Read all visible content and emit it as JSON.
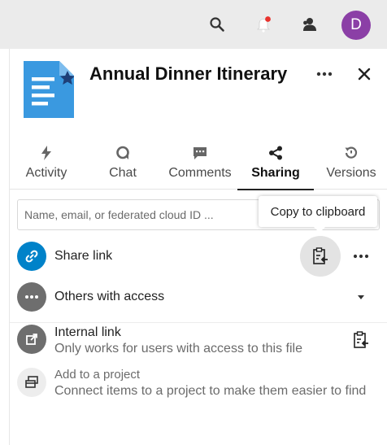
{
  "header": {
    "avatar_initial": "D",
    "notification_dot_color": "#e9322d",
    "icons": [
      "search-icon",
      "notifications-icon",
      "contacts-icon"
    ]
  },
  "file": {
    "title": "Annual Dinner Itinerary",
    "icon": "document-starred-icon",
    "icon_color": "#3a99e0"
  },
  "tabs": [
    {
      "label": "Activity",
      "icon": "lightning-icon"
    },
    {
      "label": "Chat",
      "icon": "chat-icon"
    },
    {
      "label": "Comments",
      "icon": "comment-icon"
    },
    {
      "label": "Sharing",
      "icon": "share-icon",
      "active": true
    },
    {
      "label": "Versions",
      "icon": "history-icon"
    }
  ],
  "sharing": {
    "search_placeholder": "Name, email, or federated cloud ID ...",
    "tooltip": "Copy to clipboard",
    "share_link_label": "Share link",
    "others_label": "Others with access",
    "internal_link_label": "Internal link",
    "internal_link_sub": "Only works for users with access to this file",
    "project_label": "Add to a project",
    "project_sub": "Connect items to a project to make them easier to find"
  },
  "colors": {
    "accent_blue": "#0082c9",
    "grey_circle": "#6e6e6e",
    "avatar_purple": "#8b3fa6"
  }
}
